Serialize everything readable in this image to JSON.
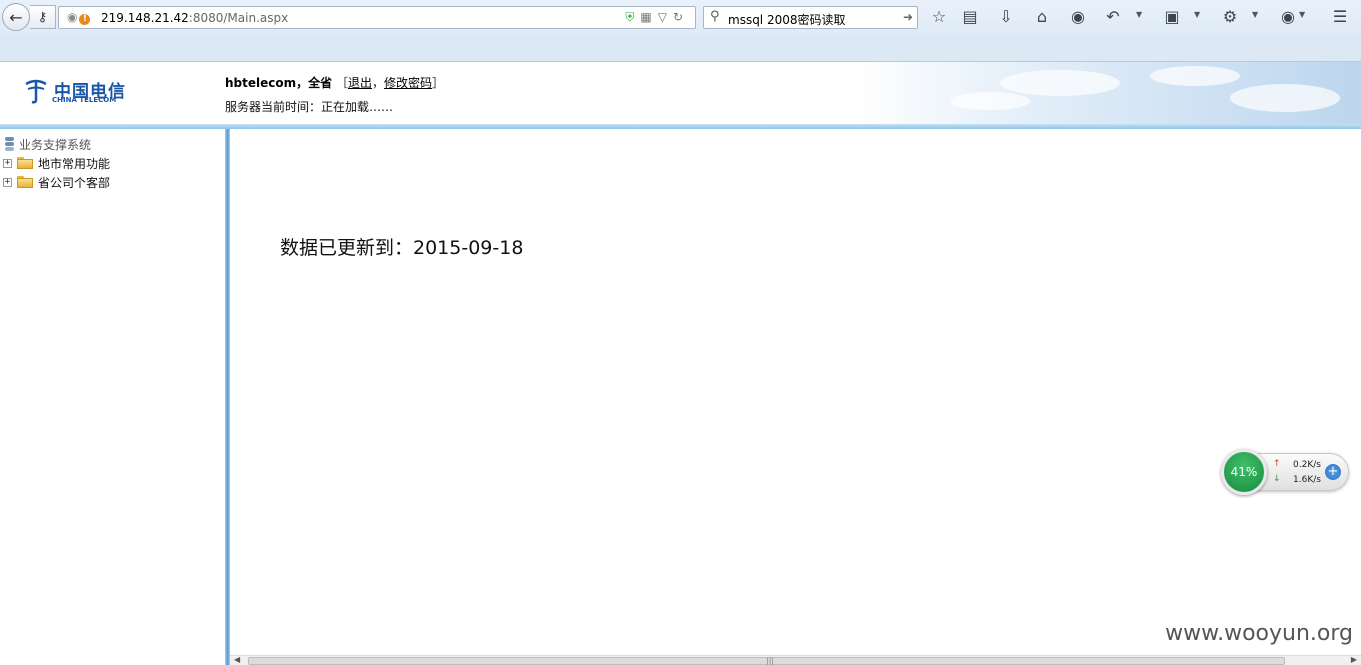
{
  "browser": {
    "url_host": "219.148.21.42",
    "url_rest": ":8080/Main.aspx",
    "search_query": "mssql 2008密码读取"
  },
  "header": {
    "logo_cn": "中国电信",
    "logo_en": "CHINA TELECOM",
    "username": "hbtelecom",
    "sep": "，",
    "region": "全省",
    "bracket_open": "［",
    "logout_label": "退出",
    "comma": "，",
    "change_password_label": "修改密码",
    "bracket_close": "］",
    "server_time_label": "服务器当前时间：",
    "server_time_value": "正在加载……"
  },
  "sidebar": {
    "root_label": "业务支撑系统",
    "items": [
      {
        "label": "地市常用功能"
      },
      {
        "label": "省公司个客部"
      }
    ]
  },
  "main": {
    "update_text": "数据已更新到：2015-09-18"
  },
  "watermark": "www.wooyun.org",
  "net_widget": {
    "percent_text": "41%",
    "upload": "0.2K/s",
    "download": "1.6K/s"
  },
  "colors": {
    "accent": "#4f9bd8",
    "brand": "#1a56a8"
  }
}
